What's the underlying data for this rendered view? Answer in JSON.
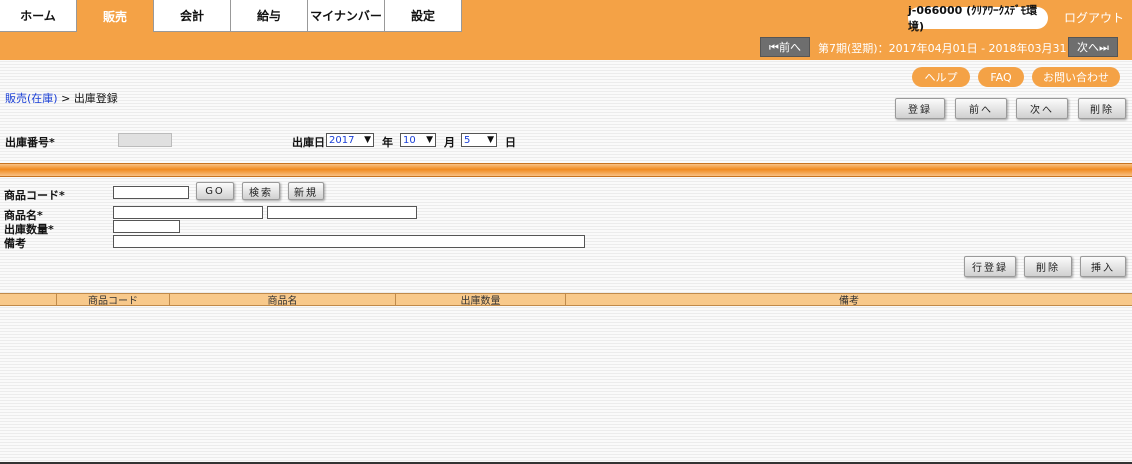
{
  "nav": {
    "tabs": [
      {
        "label": "ホーム",
        "active": false
      },
      {
        "label": "販売",
        "active": true
      },
      {
        "label": "会計",
        "active": false
      },
      {
        "label": "給与",
        "active": false
      },
      {
        "label": "マイナンバー",
        "active": false
      },
      {
        "label": "設定",
        "active": false
      }
    ],
    "user": "j-066000 (ｸﾘｱﾜｰｸｽﾃﾞﾓ環境)",
    "logout": "ログアウト"
  },
  "period": {
    "prev": "⏮前へ",
    "text": "第7期(翌期)：2017年04月01日 - 2018年03月31日",
    "next": "次へ⏭"
  },
  "help_links": {
    "help": "ヘルプ",
    "faq": "FAQ",
    "contact": "お問い合わせ"
  },
  "breadcrumb": {
    "parent": "販売(在庫)",
    "sep": " > ",
    "current": "出庫登録"
  },
  "toolbar": {
    "register": "登録",
    "prev": "前へ",
    "next": "次へ",
    "delete": "削除"
  },
  "header_form": {
    "number_label": "出庫番号*",
    "date_label": "出庫日",
    "year": "2017",
    "year_unit": "年",
    "month": "10",
    "month_unit": "月",
    "day": "5",
    "day_unit": "日"
  },
  "detail_form": {
    "code_label": "商品コード*",
    "go": "GO",
    "search": "検索",
    "new": "新規",
    "name_label": "商品名*",
    "qty_label": "出庫数量*",
    "note_label": "備考"
  },
  "row_actions": {
    "register": "行登録",
    "delete": "削除",
    "insert": "挿入"
  },
  "table": {
    "headers": [
      "",
      "商品コード",
      "商品名",
      "出庫数量",
      "備考"
    ]
  }
}
